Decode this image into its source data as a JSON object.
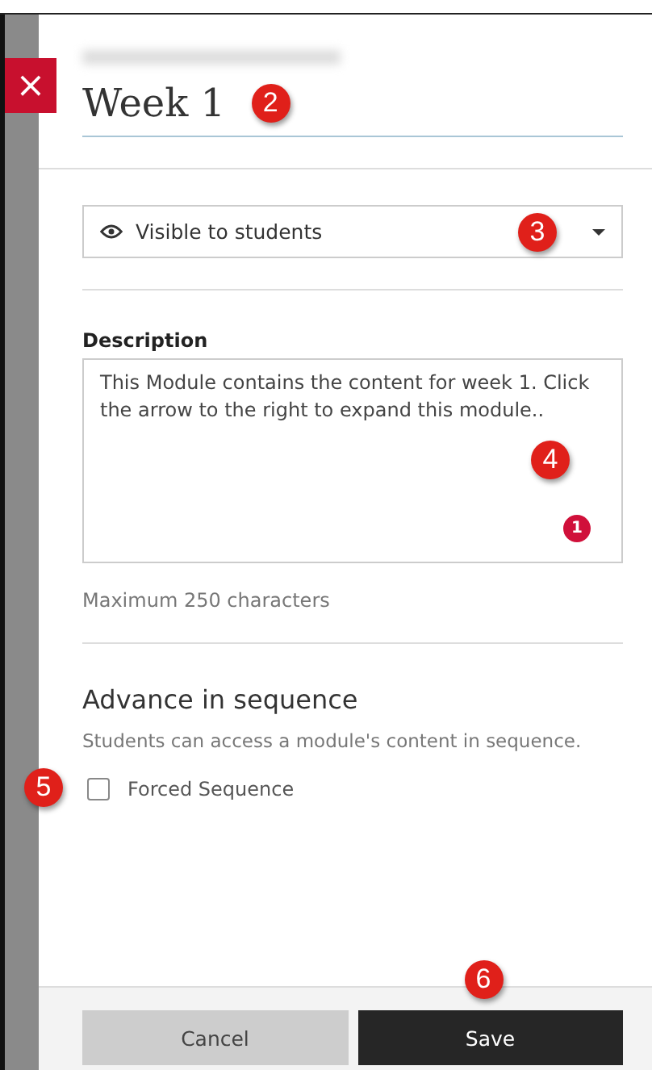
{
  "panel": {
    "title": "Week 1",
    "close_icon": "×",
    "callout": "2"
  },
  "visibility": {
    "value": "Visible to students",
    "callout": "3"
  },
  "description": {
    "label": "Description",
    "value": "This Module contains the content for week 1.  Click the arrow to the right to expand this module..",
    "callout": "4",
    "badge": "1",
    "hint": "Maximum 250 characters"
  },
  "sequence": {
    "heading": "Advance in sequence",
    "text": "Students can access a module's content in sequence.",
    "option": {
      "label": "Forced Sequence",
      "checked": false,
      "callout": "5"
    }
  },
  "buttons": [
    {
      "label": "Cancel",
      "kind": "secondary"
    },
    {
      "label": "Save",
      "kind": "primary",
      "callout": "6"
    }
  ]
}
